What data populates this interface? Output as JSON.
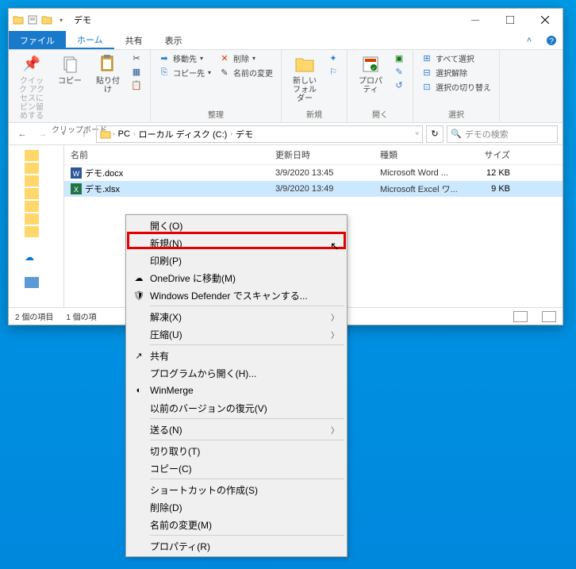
{
  "window": {
    "title": "デモ",
    "tabs": {
      "file": "ファイル",
      "home": "ホーム",
      "share": "共有",
      "view": "表示"
    }
  },
  "ribbon": {
    "clipboard": {
      "label": "クリップボード",
      "pin": "クイック アクセスにピン留めする",
      "copy": "コピー",
      "paste": "貼り付け",
      "cut": "",
      "copypath": "",
      "pasteshortcut": ""
    },
    "organize": {
      "label": "整理",
      "moveto": "移動先",
      "delete": "削除",
      "copyto": "コピー先",
      "rename": "名前の変更"
    },
    "new": {
      "label": "新規",
      "newfolder": "新しいフォルダー"
    },
    "open": {
      "label": "開く",
      "properties": "プロパティ"
    },
    "select": {
      "label": "選択",
      "selectall": "すべて選択",
      "selectnone": "選択解除",
      "invert": "選択の切り替え"
    }
  },
  "breadcrumb": {
    "pc": "PC",
    "c": "ローカル ディスク (C:)",
    "folder": "デモ"
  },
  "search": {
    "placeholder": "デモの検索"
  },
  "columns": {
    "name": "名前",
    "date": "更新日時",
    "type": "種類",
    "size": "サイズ"
  },
  "files": [
    {
      "icon": "word",
      "name": "デモ.docx",
      "date": "3/9/2020 13:45",
      "type": "Microsoft Word ...",
      "size": "12 KB",
      "selected": false
    },
    {
      "icon": "excel",
      "name": "デモ.xlsx",
      "date": "3/9/2020 13:49",
      "type": "Microsoft Excel ワ...",
      "size": "9 KB",
      "selected": true
    }
  ],
  "status": {
    "count": "2 個の項目",
    "selected": "1 個の項"
  },
  "context_menu": [
    {
      "label": "開く(O)",
      "type": "item"
    },
    {
      "label": "新規(N)",
      "type": "item",
      "highlighted": true
    },
    {
      "label": "印刷(P)",
      "type": "item"
    },
    {
      "label": "OneDrive に移動(M)",
      "type": "item",
      "icon": "onedrive"
    },
    {
      "label": "Windows Defender でスキャンする...",
      "type": "item",
      "icon": "shield"
    },
    {
      "type": "sep"
    },
    {
      "label": "解凍(X)",
      "type": "item",
      "arrow": true
    },
    {
      "label": "圧縮(U)",
      "type": "item",
      "arrow": true
    },
    {
      "type": "sep"
    },
    {
      "label": "共有",
      "type": "item",
      "icon": "share"
    },
    {
      "label": "プログラムから開く(H)...",
      "type": "item"
    },
    {
      "label": "WinMerge",
      "type": "item",
      "icon": "winmerge"
    },
    {
      "label": "以前のバージョンの復元(V)",
      "type": "item"
    },
    {
      "type": "sep"
    },
    {
      "label": "送る(N)",
      "type": "item",
      "arrow": true
    },
    {
      "type": "sep"
    },
    {
      "label": "切り取り(T)",
      "type": "item"
    },
    {
      "label": "コピー(C)",
      "type": "item"
    },
    {
      "type": "sep"
    },
    {
      "label": "ショートカットの作成(S)",
      "type": "item"
    },
    {
      "label": "削除(D)",
      "type": "item"
    },
    {
      "label": "名前の変更(M)",
      "type": "item"
    },
    {
      "type": "sep"
    },
    {
      "label": "プロパティ(R)",
      "type": "item"
    }
  ]
}
